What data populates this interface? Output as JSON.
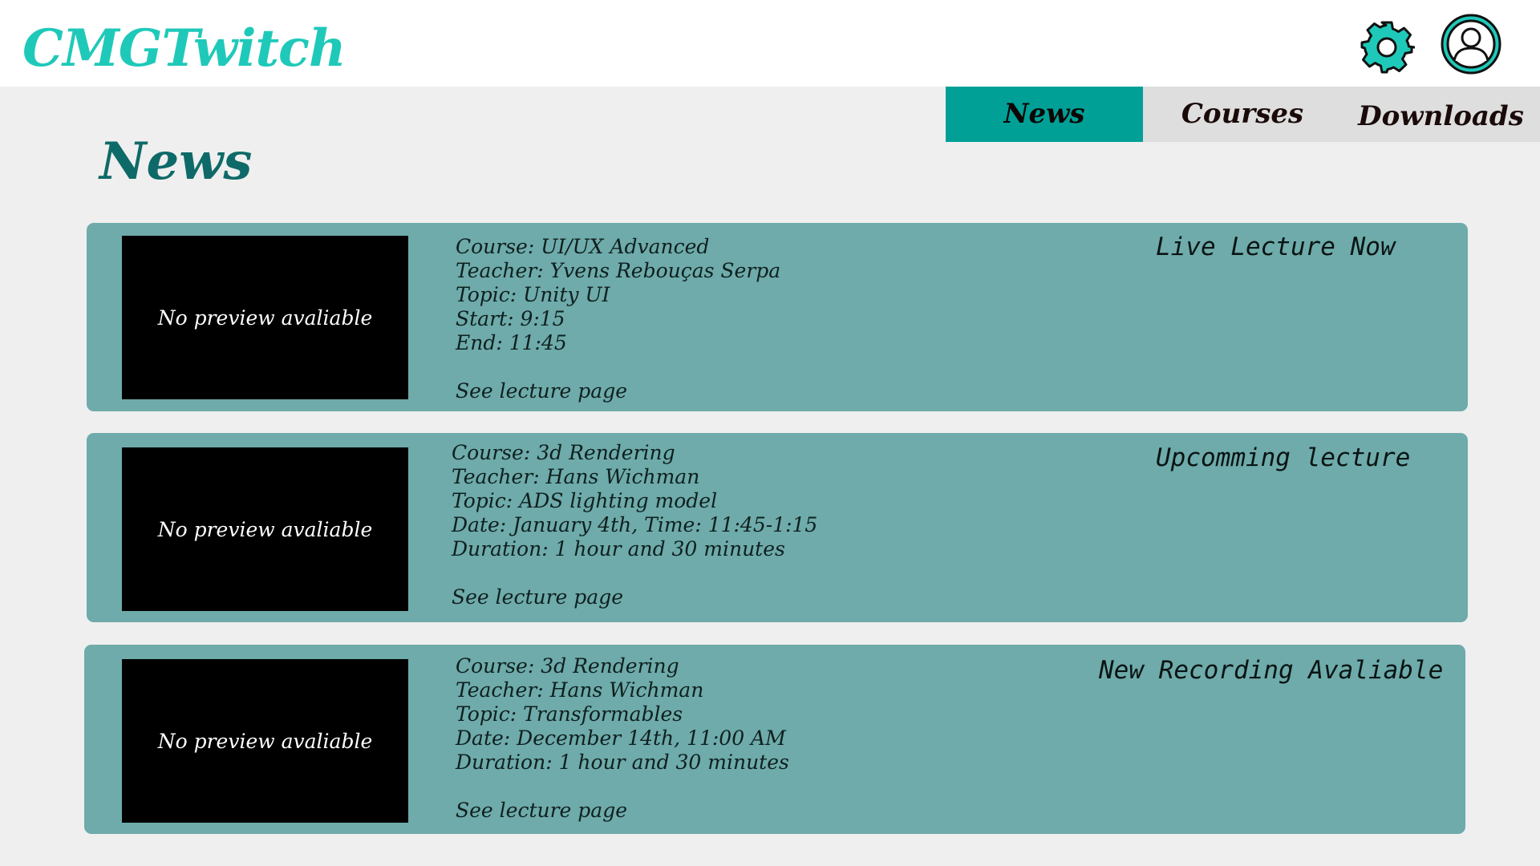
{
  "app": {
    "logo": "CMGTwitch"
  },
  "header": {
    "settings_icon": "gear-icon",
    "profile_icon": "user-avatar-icon",
    "accent_color": "#1fc9b9"
  },
  "nav": {
    "tabs": [
      {
        "label": "News",
        "active": true
      },
      {
        "label": "Courses",
        "active": false
      },
      {
        "label": "Downloads",
        "active": false
      }
    ],
    "active_color": "#00a096"
  },
  "page": {
    "title": "News"
  },
  "cards": [
    {
      "preview": "No preview avaliable",
      "status": "Live Lecture Now",
      "lines": [
        "Course: UI/UX Advanced",
        "Teacher: Yvens Rebouças Serpa",
        "Topic: Unity UI",
        "Start: 9:15",
        "End: 11:45"
      ],
      "link": "See lecture page"
    },
    {
      "preview": "No preview avaliable",
      "status": "Upcomming lecture",
      "lines": [
        "Course: 3d Rendering",
        "Teacher: Hans Wichman",
        "Topic: ADS lighting model",
        "Date: January 4th, Time: 11:45-1:15",
        "Duration: 1 hour and 30 minutes"
      ],
      "link": "See lecture page"
    },
    {
      "preview": "No preview avaliable",
      "status": "New Recording Avaliable",
      "lines": [
        "Course: 3d Rendering",
        "Teacher: Hans Wichman",
        "Topic: Transformables",
        "Date: December 14th, 11:00 AM",
        "Duration: 1 hour and 30 minutes"
      ],
      "link": "See lecture page"
    }
  ],
  "colors": {
    "card_background": "#6eabaa",
    "page_title": "#0e6a68",
    "page_background": "#efefef"
  }
}
